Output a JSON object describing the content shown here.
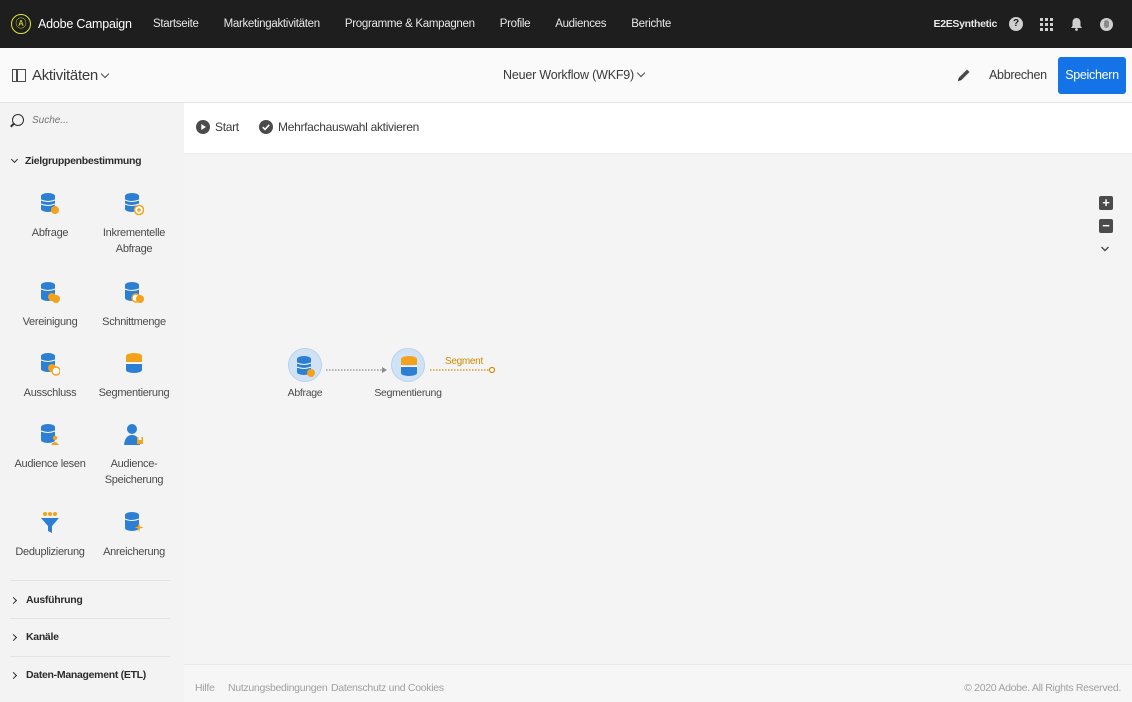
{
  "app": {
    "brand": "Adobe Campaign",
    "logo_glyph": "Ⓐ"
  },
  "nav": {
    "items": [
      {
        "label": "Startseite"
      },
      {
        "label": "Marketingaktivitäten"
      },
      {
        "label": "Programme & Kampagnen"
      },
      {
        "label": "Profile"
      },
      {
        "label": "Audiences"
      },
      {
        "label": "Berichte"
      }
    ],
    "org_name": "E2ESynthetic",
    "help_glyph": "?"
  },
  "header": {
    "activities_label": "Aktivitäten",
    "workflow_title": "Neuer Workflow (WKF9)",
    "cancel_label": "Abbrechen",
    "save_label": "Speichern"
  },
  "sidebar": {
    "search_placeholder": "Suche...",
    "sections": [
      {
        "label": "Zielgruppenbestimmung",
        "expanded": true
      },
      {
        "label": "Ausführung",
        "expanded": false
      },
      {
        "label": "Kanäle",
        "expanded": false
      },
      {
        "label": "Daten-Management (ETL)",
        "expanded": false
      }
    ],
    "tiles": [
      {
        "label": "Abfrage",
        "icon": "query-icon"
      },
      {
        "label": "Inkrementelle Abfrage",
        "icon": "incremental-query-icon"
      },
      {
        "label": "Vereinigung",
        "icon": "union-icon"
      },
      {
        "label": "Schnittmenge",
        "icon": "intersection-icon"
      },
      {
        "label": "Ausschluss",
        "icon": "exclusion-icon"
      },
      {
        "label": "Segmentierung",
        "icon": "segmentation-icon"
      },
      {
        "label": "Audience lesen",
        "icon": "read-audience-icon"
      },
      {
        "label": "Audience-Speicherung",
        "icon": "save-audience-icon"
      },
      {
        "label": "Deduplizierung",
        "icon": "deduplication-icon"
      },
      {
        "label": "Anreicherung",
        "icon": "enrichment-icon"
      }
    ]
  },
  "toolbar": {
    "start_label": "Start",
    "multiselect_label": "Mehrfachauswahl aktivieren"
  },
  "canvas": {
    "zoom_in_glyph": "+",
    "zoom_out_glyph": "−",
    "nodes": [
      {
        "label": "Abfrage",
        "icon": "query-icon"
      },
      {
        "label": "Segmentierung",
        "icon": "segmentation-icon"
      }
    ],
    "transition_label": "Segment"
  },
  "footer": {
    "links": [
      {
        "label": "Hilfe"
      },
      {
        "label": "Nutzungsbedingungen"
      },
      {
        "label": "Datenschutz und Cookies"
      }
    ],
    "copyright": "© 2020 Adobe. All Rights Reserved."
  },
  "colors": {
    "topbar": "#1e1e1e",
    "primary_button": "#1473e6",
    "db_blue": "#2d7fd3",
    "accent_orange": "#f2a21b",
    "node_bg": "#cfe2f6",
    "transition": "#d08a00"
  }
}
